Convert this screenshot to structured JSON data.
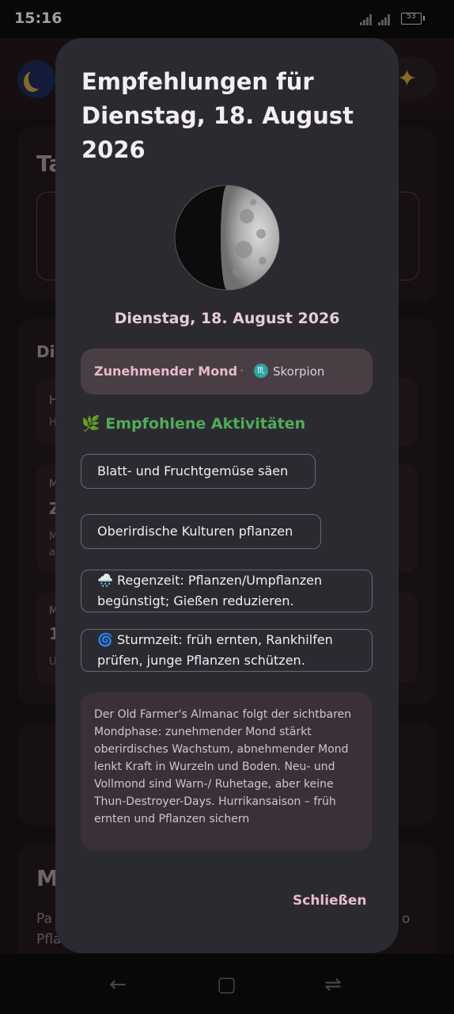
{
  "status_bar": {
    "time": "15:16",
    "battery": "53"
  },
  "dialog": {
    "title": "Empfehlungen für Dienstag, 18. August 2026",
    "date_subtitle": "Dienstag, 18. August 2026",
    "moon_phase": "Zunehmender Mond",
    "separator": "·",
    "zodiac_symbol": "♏",
    "zodiac": "Skorpion",
    "activities_title": "🌿 Empfohlene Aktivitäten",
    "activities": [
      "Blatt- und Fruchtgemüse säen",
      "Oberirdische Kulturen pflanzen",
      "🌧️ Regenzeit: Pflanzen/Umpflanzen begünstigt; Gießen reduzieren.",
      "🌀 Sturmzeit: früh ernten, Rankhilfen prüfen, junge Pflanzen schützen."
    ],
    "note": "Der Old Farmer's Almanac folgt der sichtbaren Mondphase: zunehmender Mond stärkt oberirdisches Wachstum, abnehmender Mond lenkt Kraft in Wurzeln und Boden. Neu- und Vollmond sind Warn-/ Ruhetage, aber keine Thun-Destroyer-Days. Hurrikansaison – früh ernten und Pflanzen sichern",
    "close_label": "Schließen"
  },
  "background": {
    "header_star": "✦",
    "card1_title_partial": "Ta",
    "card2_title_partial": "Di",
    "card3_title_partial": "M",
    "card3_body_partial_1": "Pa",
    "card3_body_partial_2": "Pfla",
    "card3_body_partial_right": "o",
    "list_letters": [
      "H",
      "H",
      "M",
      "Z",
      "M",
      "a",
      "M",
      "1",
      "U"
    ]
  },
  "nav": {
    "back_icon": "←",
    "home_icon": "▢",
    "recents_icon": "⇌"
  },
  "colors": {
    "dialog_bg": "#2c2a31",
    "accent_pink": "#e8bccd",
    "activity_green": "#4fae57",
    "phase_box": "#4a3e45",
    "note_bg": "#3b3039"
  }
}
